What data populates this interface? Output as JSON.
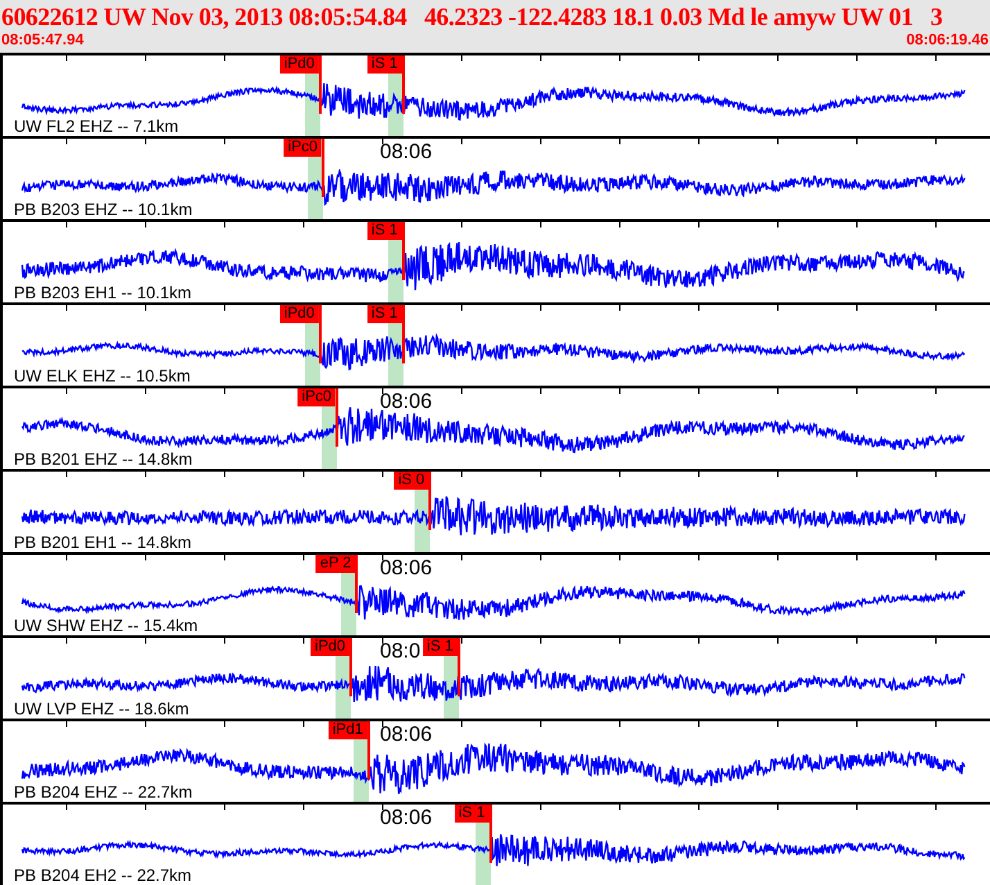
{
  "header": {
    "title": "60622612 UW Nov 03, 2013 08:05:54.84   46.2323 -122.4283 18.1 0.03 Md le amyw UW 01   3",
    "start_time": "08:05:47.94",
    "end_time": "08:06:19.46"
  },
  "traces": [
    {
      "label": "UW FL2 EHZ -- 7.1km",
      "picks": [
        {
          "label": "iPd0",
          "level": 0.322
        },
        {
          "label": "iS 1",
          "level": 0.406
        }
      ]
    },
    {
      "label": "PB B203 EHZ -- 10.1km",
      "time_label": "08:06",
      "picks": [
        {
          "label": "iPc0",
          "level": 0.325
        }
      ]
    },
    {
      "label": "PB B203 EH1 -- 10.1km",
      "picks": [
        {
          "label": "iS 1",
          "level": 0.406
        }
      ]
    },
    {
      "label": "UW ELK EHZ -- 10.5km",
      "picks": [
        {
          "label": "iPd0",
          "level": 0.322
        },
        {
          "label": "iS 1",
          "level": 0.406
        }
      ]
    },
    {
      "label": "PB B201 EHZ -- 14.8km",
      "time_label": "08:06",
      "picks": [
        {
          "label": "iPc0",
          "level": 0.339
        }
      ]
    },
    {
      "label": "PB B201 EH1 -- 14.8km",
      "picks": [
        {
          "label": "iS 0",
          "level": 0.433
        }
      ]
    },
    {
      "label": "UW SHW EHZ -- 15.4km",
      "time_label": "08:06",
      "picks": [
        {
          "label": "eP 2",
          "level": 0.359
        }
      ]
    },
    {
      "label": "UW LVP EHZ -- 18.6km",
      "time_label": "08:0",
      "picks": [
        {
          "label": "iPd0",
          "level": 0.353
        },
        {
          "label": "iS 1",
          "level": 0.462
        }
      ]
    },
    {
      "label": "PB B204 EHZ -- 22.7km",
      "time_label": "08:06",
      "picks": [
        {
          "label": "iPd1",
          "level": 0.371
        }
      ]
    },
    {
      "label": "PB B204 EH2 -- 22.7km",
      "time_label": "08:06",
      "picks": [
        {
          "label": "iS 1",
          "level": 0.494
        }
      ]
    }
  ]
}
